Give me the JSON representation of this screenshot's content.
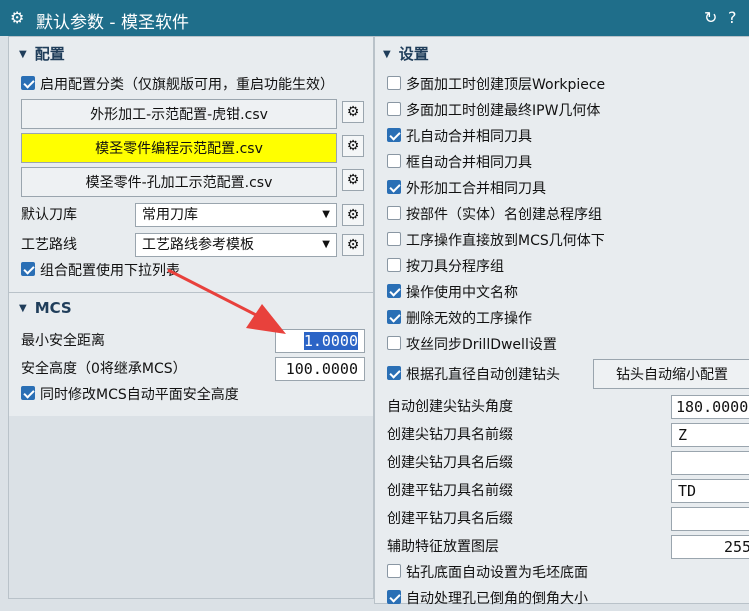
{
  "window": {
    "title": "默认参数 - 模圣软件",
    "refresh_icon": "refresh-icon",
    "help_label": "?"
  },
  "config": {
    "header": "配置",
    "enable_classify": "启用配置分类（仅旗舰版可用，重启功能生效）",
    "enable_classify_checked": true,
    "files": [
      {
        "label": "外形加工-示范配置-虎钳.csv",
        "highlight": false
      },
      {
        "label": "模圣零件编程示范配置.csv",
        "highlight": true
      },
      {
        "label": "模圣零件-孔加工示范配置.csv",
        "highlight": false
      }
    ],
    "tool_lib_label": "默认刀库",
    "tool_lib_value": "常用刀库",
    "process_label": "工艺路线",
    "process_value": "工艺路线参考模板",
    "dropdown_label": "组合配置使用下拉列表",
    "dropdown_checked": true
  },
  "mcs": {
    "header": "MCS",
    "min_safe_label": "最小安全距离",
    "min_safe_value": "1.0000",
    "safe_height_label": "安全高度（0将继承MCS）",
    "safe_height_value": "100.0000",
    "sync_label": "同时修改MCS自动平面安全高度",
    "sync_checked": true
  },
  "settings": {
    "header": "设置",
    "checks": [
      {
        "label": "多面加工时创建顶层Workpiece",
        "checked": false
      },
      {
        "label": "多面加工时创建最终IPW几何体",
        "checked": false
      },
      {
        "label": "孔自动合并相同刀具",
        "checked": true
      },
      {
        "label": "框自动合并相同刀具",
        "checked": false
      },
      {
        "label": "外形加工合并相同刀具",
        "checked": true
      },
      {
        "label": "按部件（实体）名创建总程序组",
        "checked": false
      },
      {
        "label": "工序操作直接放到MCS几何体下",
        "checked": false
      },
      {
        "label": "按刀具分程序组",
        "checked": false
      },
      {
        "label": "操作使用中文名称",
        "checked": true
      },
      {
        "label": "删除无效的工序操作",
        "checked": true
      },
      {
        "label": "攻丝同步DrillDwell设置",
        "checked": false
      },
      {
        "label": "根据孔直径自动创建钻头",
        "checked": true
      }
    ],
    "drill_config_button": "钻头自动缩小配置",
    "fields": [
      {
        "label": "自动创建尖钻头角度",
        "value": "180.0000"
      },
      {
        "label": "创建尖钻刀具名前缀",
        "value": "Z"
      },
      {
        "label": "创建尖钻刀具名后缀",
        "value": ""
      },
      {
        "label": "创建平钻刀具名前缀",
        "value": "TD"
      },
      {
        "label": "创建平钻刀具名后缀",
        "value": ""
      },
      {
        "label": "辅助特征放置图层",
        "value": "255"
      }
    ],
    "bottom_check": {
      "label": "钻孔底面自动设置为毛坯底面",
      "checked": false
    },
    "partial_check": {
      "label": "自动处理孔已倒角的倒角大小",
      "checked": true
    }
  },
  "colors": {
    "titlebar": "#1f6e8a",
    "highlight": "#ffff00",
    "selection": "#2b64c6",
    "arrow": "#e8413c"
  }
}
